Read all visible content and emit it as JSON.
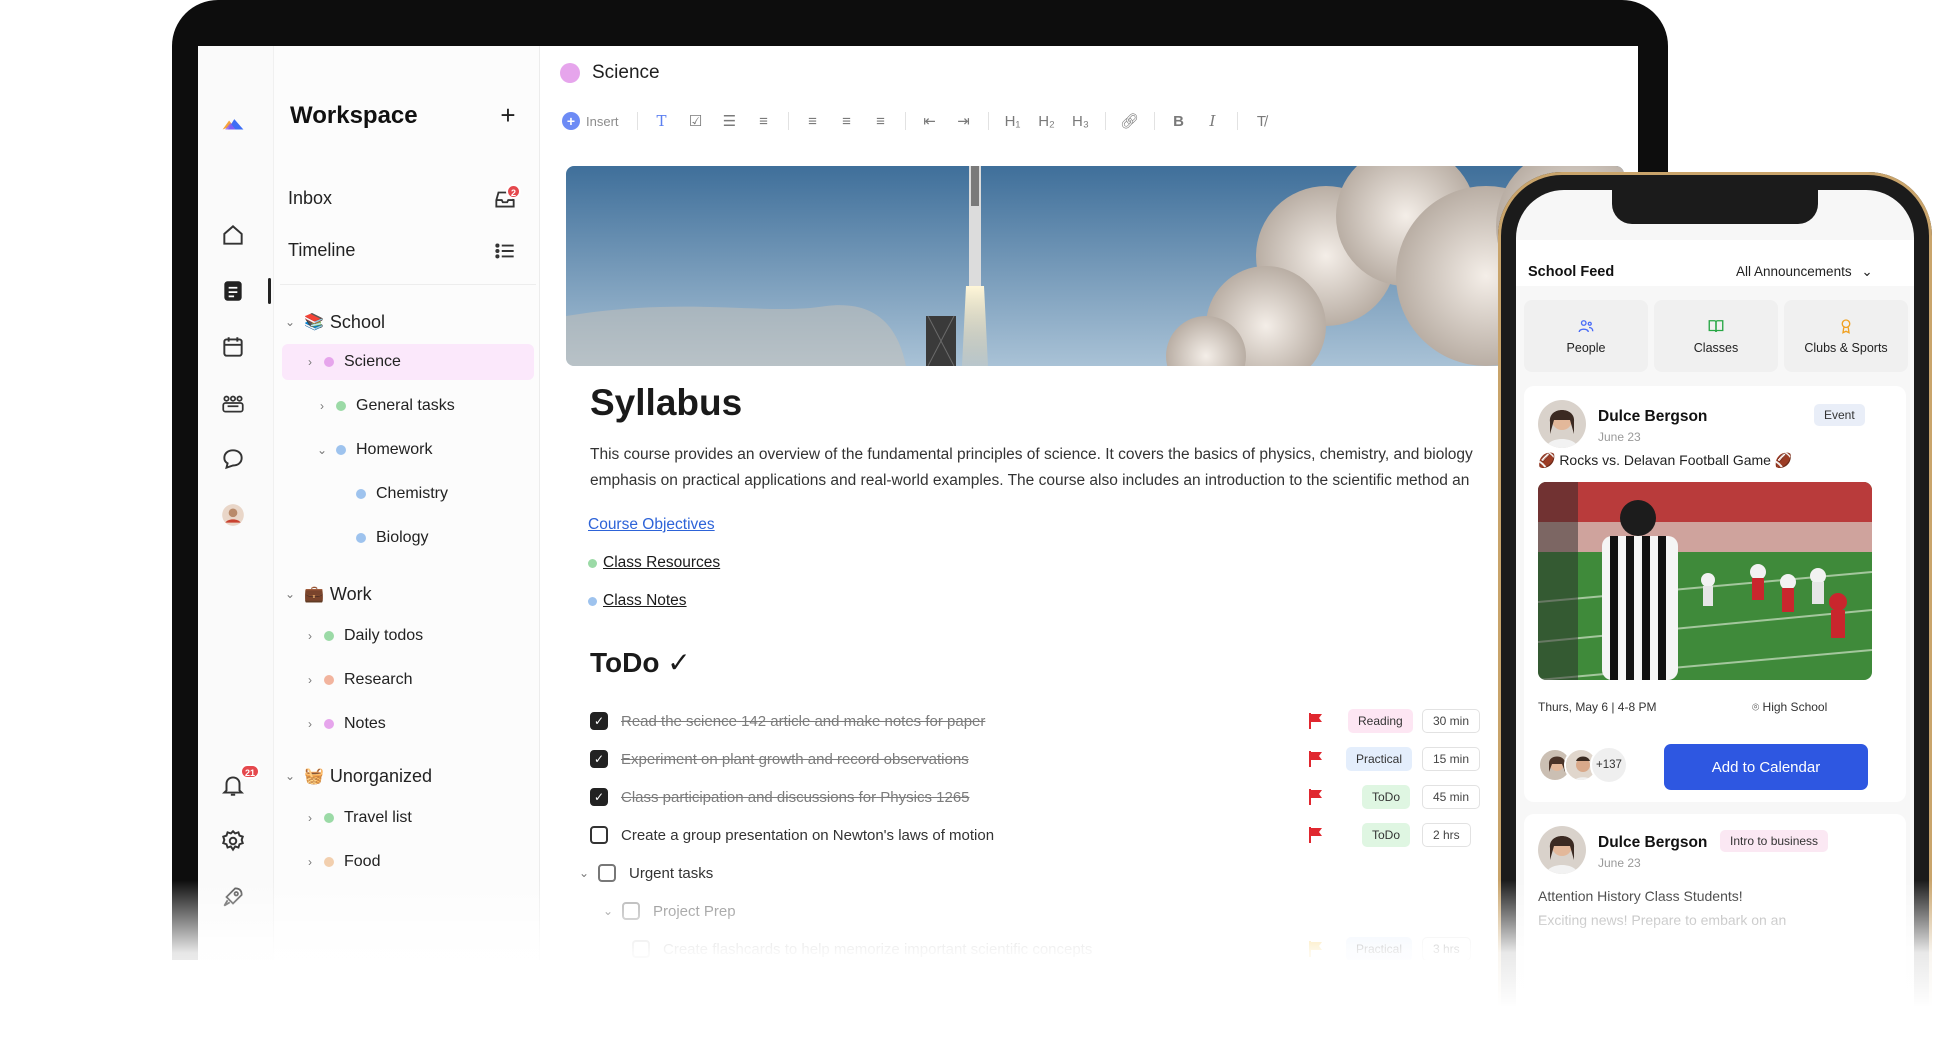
{
  "workspace": {
    "title": "Workspace",
    "inbox_label": "Inbox",
    "inbox_badge": "2",
    "timeline_label": "Timeline",
    "groups": [
      {
        "label": "School",
        "emoji": "📚",
        "items": [
          {
            "label": "Science",
            "color": "#e6a5ec",
            "selected": true
          },
          {
            "label": "General tasks",
            "color": "#9bdaa6"
          },
          {
            "label": "Homework",
            "color": "#9ec3ee",
            "children": [
              {
                "label": "Chemistry",
                "color": "#9ec3ee"
              },
              {
                "label": "Biology",
                "color": "#9ec3ee"
              }
            ]
          }
        ]
      },
      {
        "label": "Work",
        "emoji": "💼",
        "items": [
          {
            "label": "Daily todos",
            "color": "#9bdaa6"
          },
          {
            "label": "Research",
            "color": "#f2b49e"
          },
          {
            "label": "Notes",
            "color": "#e6a5ec"
          }
        ]
      },
      {
        "label": "Unorganized",
        "emoji": "🧺",
        "items": [
          {
            "label": "Travel list",
            "color": "#9bdaa6"
          },
          {
            "label": "Food",
            "color": "#f2cfae"
          }
        ]
      }
    ]
  },
  "rail": {
    "notification_badge": "21",
    "icons": [
      "home-icon",
      "notes-icon",
      "calendar-icon",
      "community-icon",
      "chat-icon",
      "profile-avatar",
      "bell-icon",
      "settings-icon",
      "rocket-icon"
    ]
  },
  "page": {
    "title": "Science",
    "toolbar": {
      "insert_label": "Insert",
      "h1": "H₁",
      "h2": "H₂",
      "h3": "H₃",
      "bold": "B",
      "italic": "I"
    },
    "doc_title": "Syllabus",
    "paragraph_line1": "This course provides an overview of the fundamental principles of science. It covers the basics of physics, chemistry, and biology",
    "paragraph_line2": "emphasis on practical applications and real-world examples. The course also includes an introduction to the scientific method an",
    "links": {
      "objectives": "Course Objectives",
      "resources": "Class Resources",
      "notes": "Class Notes"
    },
    "todo_title": "ToDo ✓",
    "tasks": [
      {
        "text": "Read the science 142 article and make notes for paper",
        "done": true,
        "tag": "Reading",
        "duration": "30 min"
      },
      {
        "text": "Experiment on plant growth and record observations",
        "done": true,
        "tag": "Practical",
        "duration": "15 min"
      },
      {
        "text": "Class participation and discussions for Physics 1265",
        "done": true,
        "tag": "ToDo",
        "duration": "45 min"
      },
      {
        "text": "Create a group presentation on Newton's laws of motion",
        "done": false,
        "tag": "ToDo",
        "duration": "2 hrs"
      },
      {
        "text": "Urgent tasks",
        "done": false
      },
      {
        "text": "Project Prep",
        "done": false
      },
      {
        "text": "Create flashcards to help memorize important scientific concepts",
        "done": false,
        "tag": "Practical",
        "duration": "3 hrs"
      }
    ],
    "colors": {
      "flag_red": "#e0272f",
      "flag_yellow": "#f5c542"
    }
  },
  "phone": {
    "feed_title": "School Feed",
    "filter_label": "All Announcements",
    "tabs": [
      {
        "label": "People",
        "icon": "people-icon",
        "color": "#4a6cf7"
      },
      {
        "label": "Classes",
        "icon": "book-icon",
        "color": "#28a745"
      },
      {
        "label": "Clubs & Sports",
        "icon": "trophy-icon",
        "color": "#f0a020"
      }
    ],
    "posts": [
      {
        "author": "Dulce Bergson",
        "date": "June 23",
        "pill": "Event",
        "text": "🏈 Rocks vs. Delavan Football Game 🏈",
        "when": "Thurs, May 6 | 4-8 PM",
        "where": "High School",
        "attendees": "+137",
        "cta": "Add to Calendar"
      },
      {
        "author": "Dulce Bergson",
        "date": "June 23",
        "pill": "Intro to business",
        "headline": "Attention History Class Students!",
        "preview": "Exciting news! Prepare to embark on an"
      }
    ],
    "accent": "#2e57e1"
  }
}
